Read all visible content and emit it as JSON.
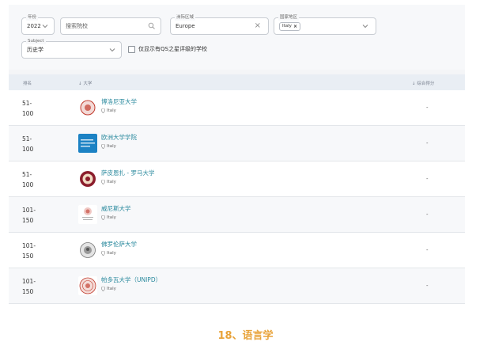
{
  "filters": {
    "year": {
      "label": "年份",
      "value": "2022"
    },
    "search": {
      "placeholder": "搜索院校"
    },
    "region": {
      "label": "洲际区域",
      "value": "Europe"
    },
    "country": {
      "label": "国家地区",
      "chip": "Italy"
    },
    "subject": {
      "label": "Subject",
      "value": "历史学"
    },
    "qs_stars_only": {
      "label": "仅显示有QS之星评级的学校",
      "checked": false
    }
  },
  "table": {
    "headers": {
      "rank": "排名",
      "university": "大学",
      "score": "综合得分"
    },
    "rows": [
      {
        "rank": "51-\n100",
        "name": "博洛尼亚大学",
        "country": "Italy",
        "score": "-",
        "logo_icon": "bologna-seal-icon",
        "logo_color": "#c0392b"
      },
      {
        "rank": "51-\n100",
        "name": "欧洲大学学院",
        "country": "Italy",
        "score": "-",
        "logo_icon": "eui-logo-icon",
        "logo_color": "#1c82c4"
      },
      {
        "rank": "51-\n100",
        "name": "萨皮恩扎 - 罗马大学",
        "country": "Italy",
        "score": "-",
        "logo_icon": "sapienza-seal-icon",
        "logo_color": "#8b1d2c"
      },
      {
        "rank": "101-\n150",
        "name": "威尼斯大学",
        "country": "Italy",
        "score": "-",
        "logo_icon": "venice-logo-icon",
        "logo_color": "#c0392b"
      },
      {
        "rank": "101-\n150",
        "name": "佛罗伦萨大学",
        "country": "Italy",
        "score": "-",
        "logo_icon": "florence-seal-icon",
        "logo_color": "#555555"
      },
      {
        "rank": "101-\n150",
        "name": "帕多瓦大学（UNIPD）",
        "country": "Italy",
        "score": "-",
        "logo_icon": "padova-seal-icon",
        "logo_color": "#c0392b"
      }
    ]
  },
  "caption": "18、语言学",
  "colors": {
    "accent": "#2b8a9e",
    "caption": "#e8a33a",
    "header_bg": "#e9eef4"
  }
}
